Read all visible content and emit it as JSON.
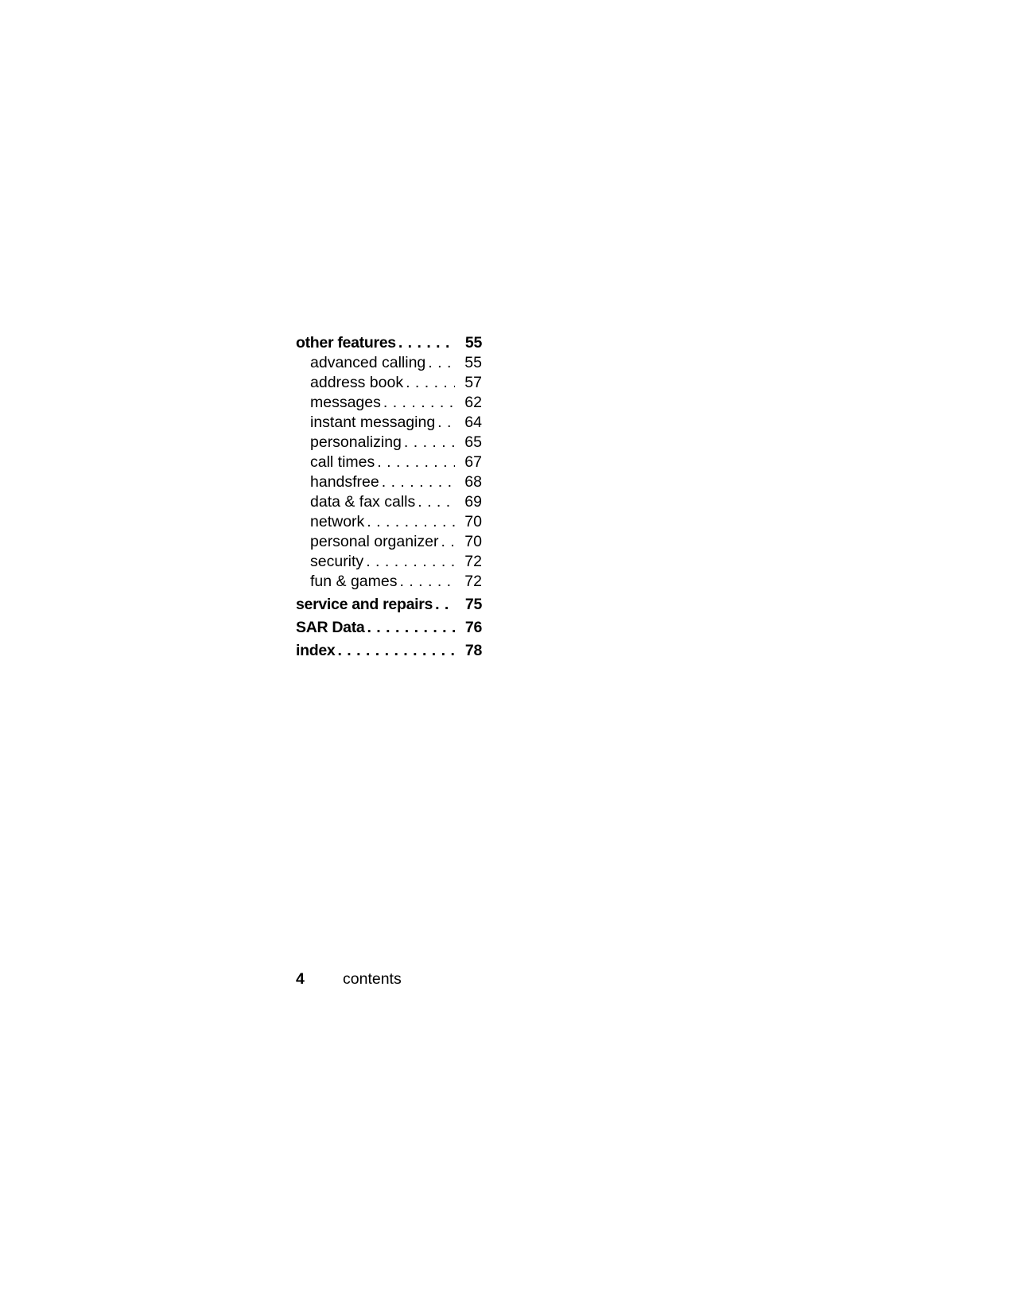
{
  "toc": {
    "entries": [
      {
        "label": "other features",
        "page": "55",
        "level": "main"
      },
      {
        "label": "advanced calling",
        "page": "55",
        "level": "sub"
      },
      {
        "label": "address book",
        "page": "57",
        "level": "sub"
      },
      {
        "label": "messages",
        "page": "62",
        "level": "sub"
      },
      {
        "label": "instant messaging",
        "page": "64",
        "level": "sub"
      },
      {
        "label": "personalizing",
        "page": "65",
        "level": "sub"
      },
      {
        "label": "call times",
        "page": "67",
        "level": "sub"
      },
      {
        "label": "handsfree",
        "page": "68",
        "level": "sub"
      },
      {
        "label": "data & fax calls",
        "page": "69",
        "level": "sub"
      },
      {
        "label": "network",
        "page": "70",
        "level": "sub"
      },
      {
        "label": "personal organizer",
        "page": "70",
        "level": "sub"
      },
      {
        "label": "security",
        "page": "72",
        "level": "sub"
      },
      {
        "label": "fun & games",
        "page": "72",
        "level": "sub"
      },
      {
        "label": "service and repairs",
        "page": "75",
        "level": "main"
      },
      {
        "label": "SAR Data",
        "page": "76",
        "level": "main"
      },
      {
        "label": "index",
        "page": "78",
        "level": "main"
      }
    ]
  },
  "footer": {
    "page_number": "4",
    "section": "contents"
  }
}
